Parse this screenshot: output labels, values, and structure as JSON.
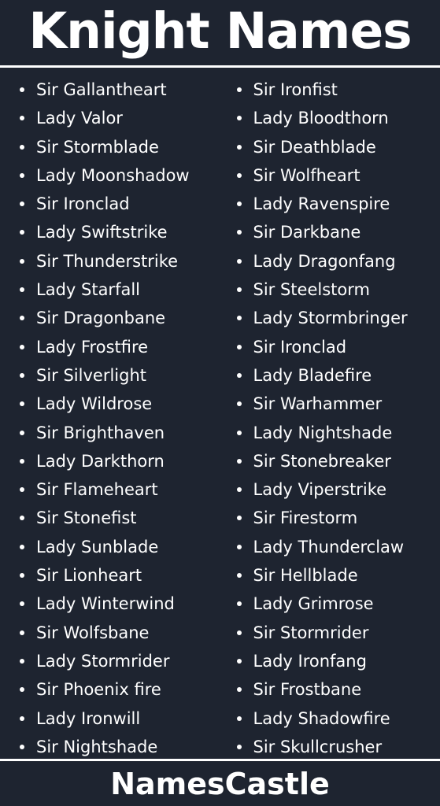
{
  "header": {
    "title": "Knight Names"
  },
  "footer": {
    "brand": "NamesCastle"
  },
  "colors": {
    "background": "#1e2430",
    "text": "#ffffff",
    "rule": "#ffffff"
  },
  "columns": [
    {
      "items": [
        "Sir Gallantheart",
        "Lady Valor",
        "Sir Stormblade",
        "Lady Moonshadow",
        "Sir Ironclad",
        "Lady Swiftstrike",
        "Sir Thunderstrike",
        "Lady Starfall",
        "Sir Dragonbane",
        "Lady Frostfire",
        "Sir Silverlight",
        "Lady Wildrose",
        "Sir Brighthaven",
        "Lady Darkthorn",
        "Sir Flameheart",
        "Sir Stonefist",
        "Lady Sunblade",
        "Sir Lionheart",
        "Lady Winterwind",
        "Sir Wolfsbane",
        "Lady Stormrider",
        "Sir Phoenix fire",
        "Lady Ironwill",
        "Sir Nightshade"
      ]
    },
    {
      "items": [
        "Sir Ironfist",
        "Lady Bloodthorn",
        "Sir Deathblade",
        "Sir Wolfheart",
        "Lady Ravenspire",
        "Sir Darkbane",
        "Lady Dragonfang",
        "Sir Steelstorm",
        "Lady Stormbringer",
        "Sir Ironclad",
        "Lady Bladefire",
        "Sir Warhammer",
        "Lady Nightshade",
        "Sir Stonebreaker",
        "Lady Viperstrike",
        "Sir Firestorm",
        "Lady Thunderclaw",
        "Sir Hellblade",
        "Lady Grimrose",
        "Sir Stormrider",
        "Lady Ironfang",
        "Sir Frostbane",
        "Lady Shadowfire",
        "Sir Skullcrusher"
      ]
    }
  ]
}
